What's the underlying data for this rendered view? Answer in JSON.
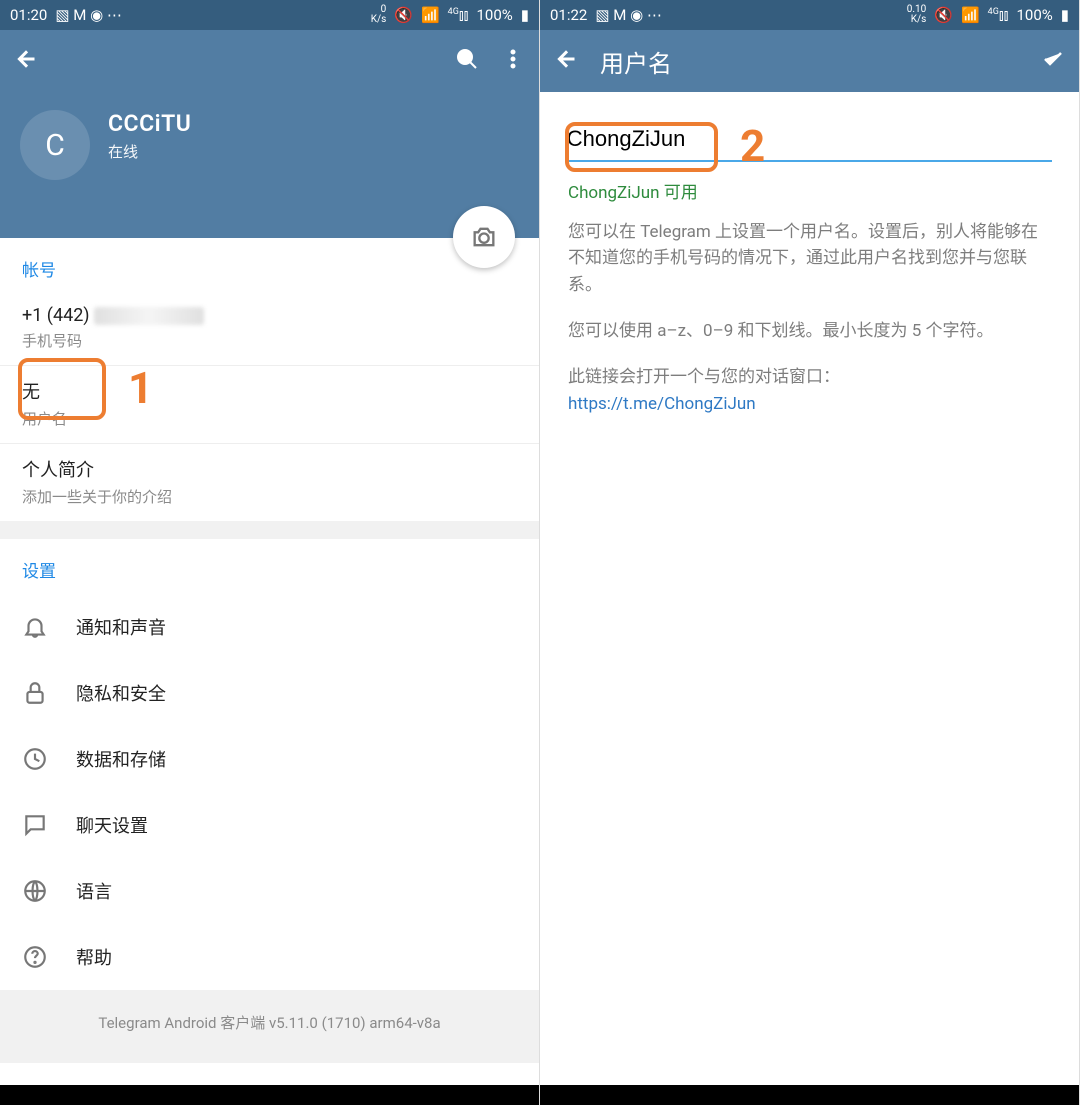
{
  "left": {
    "status": {
      "time": "01:20",
      "rate": "0\nK/s",
      "battery": "100%"
    },
    "profile": {
      "initial": "C",
      "name": "CCCiTU",
      "status": "在线"
    },
    "account": {
      "header": "帐号",
      "phone_prefix": "+1 (442) ",
      "phone_label": "手机号码",
      "username_value": "无",
      "username_label": "用户名",
      "bio_title": "个人简介",
      "bio_sub": "添加一些关于你的介绍"
    },
    "settings": {
      "header": "设置",
      "items": [
        "通知和声音",
        "隐私和安全",
        "数据和存储",
        "聊天设置",
        "语言",
        "帮助"
      ]
    },
    "footer": "Telegram Android 客户端 v5.11.0 (1710) arm64-v8a"
  },
  "right": {
    "status": {
      "time": "01:22",
      "rate": "0.10\nK/s",
      "battery": "100%"
    },
    "title": "用户名",
    "input_value": "ChongZiJun",
    "available": "ChongZiJun 可用",
    "help1": "您可以在 Telegram 上设置一个用户名。设置后，别人将能够在不知道您的手机号码的情况下，通过此用户名找到您并与您联系。",
    "help2": "您可以使用 a–z、0–9 和下划线。最小长度为 5 个字符。",
    "help3": "此链接会打开一个与您的对话窗口：",
    "link": "https://t.me/ChongZiJun"
  },
  "annotations": {
    "one": "1",
    "two": "2"
  }
}
